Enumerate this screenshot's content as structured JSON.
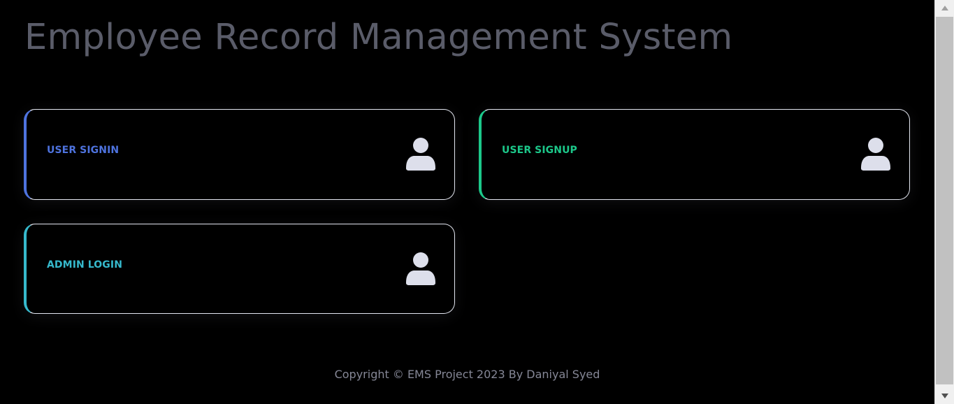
{
  "page": {
    "title": "Employee Record Management System",
    "footer": "Copyright © EMS Project 2023 By Daniyal Syed"
  },
  "cards": {
    "signin": {
      "label": "USER SIGNIN",
      "icon": "user-icon",
      "accent": "#4e73df"
    },
    "signup": {
      "label": "USER SIGNUP",
      "icon": "user-icon",
      "accent": "#1cc88a"
    },
    "admin": {
      "label": "ADMIN LOGIN",
      "icon": "user-icon",
      "accent": "#36b9cc"
    }
  },
  "colors": {
    "background": "#000000",
    "title": "#5a5c69",
    "card_border": "#e3e6f0",
    "icon_fill": "#dddfeb",
    "footer_text": "#858796"
  }
}
